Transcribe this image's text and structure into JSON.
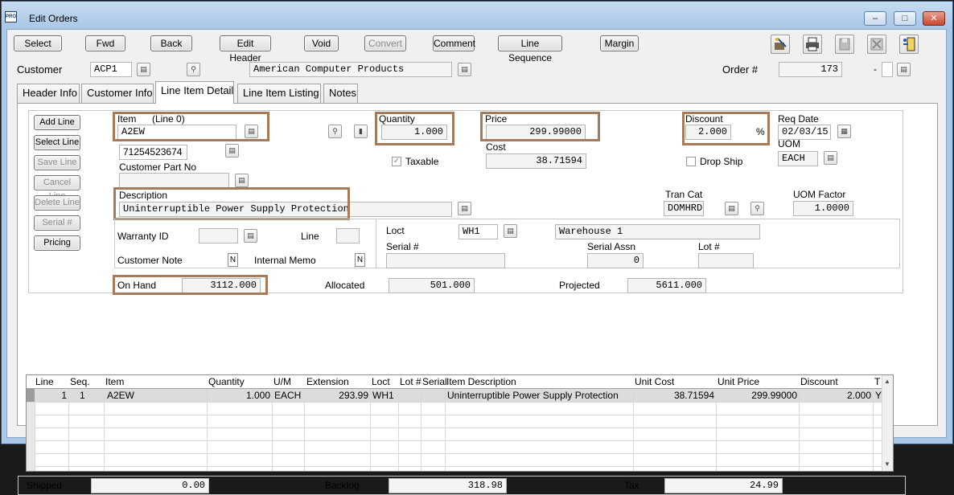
{
  "window": {
    "title": "Edit Orders",
    "app_icon_text": "PRO"
  },
  "toolbar": {
    "buttons": [
      {
        "label": "Select"
      },
      {
        "label": "Fwd"
      },
      {
        "label": "Back"
      },
      {
        "label": "Edit Header"
      },
      {
        "label": "Void"
      },
      {
        "label": "Convert"
      },
      {
        "label": "Comment"
      },
      {
        "label": "Line Sequence"
      },
      {
        "label": "Margin"
      }
    ]
  },
  "header": {
    "customer_label": "Customer",
    "customer_code": "ACP1",
    "customer_name": "American Computer Products",
    "order_label": "Order #",
    "order_number": "173",
    "order_suffix_sep": "-"
  },
  "tabs": [
    {
      "label": "Header Info"
    },
    {
      "label": "Customer Info"
    },
    {
      "label": "Line Item Detail"
    },
    {
      "label": "Line Item Listing"
    },
    {
      "label": "Notes"
    }
  ],
  "side_buttons": [
    {
      "label": "Add Line"
    },
    {
      "label": "Select Line"
    },
    {
      "label": "Save Line"
    },
    {
      "label": "Cancel Line"
    },
    {
      "label": "Delete Line"
    },
    {
      "label": "Serial #"
    },
    {
      "label": "Pricing"
    }
  ],
  "detail": {
    "item_label": "Item",
    "line_label": "(Line 0)",
    "item_value": "A2EW",
    "upc_value": "71254523674",
    "customer_part_label": "Customer Part No",
    "customer_part_value": "",
    "quantity_label": "Quantity",
    "quantity_value": "1.000",
    "taxable_label": "Taxable",
    "price_label": "Price",
    "price_value": "299.99000",
    "cost_label": "Cost",
    "cost_value": "38.71594",
    "discount_label": "Discount",
    "discount_value": "2.000",
    "discount_unit": "%",
    "drop_ship_label": "Drop Ship",
    "req_date_label": "Req Date",
    "req_date_value": "02/03/15",
    "uom_label": "UOM",
    "uom_value": "EACH",
    "description_label": "Description",
    "description_value": "Uninterruptible Power Supply Protection",
    "tran_cat_label": "Tran Cat",
    "tran_cat_value": "DOMHRD",
    "uom_factor_label": "UOM Factor",
    "uom_factor_value": "1.0000",
    "warranty_label": "Warranty ID",
    "line_field_label": "Line",
    "customer_note_label": "Customer Note",
    "customer_note_value": "N",
    "internal_memo_label": "Internal Memo",
    "internal_memo_value": "N",
    "loct_label": "Loct",
    "loct_value": "WH1",
    "warehouse_name": "Warehouse 1",
    "serial_label": "Serial #",
    "serial_assn_label": "Serial Assn",
    "serial_assn_value": "0",
    "lot_label": "Lot #",
    "on_hand_label": "On Hand",
    "on_hand_value": "3112.000",
    "allocated_label": "Allocated",
    "allocated_value": "501.000",
    "projected_label": "Projected",
    "projected_value": "5611.000"
  },
  "grid": {
    "headers": [
      "Line",
      "Seq.",
      "Item",
      "Quantity",
      "U/M",
      "Extension",
      "Loct",
      "Lot #",
      "Serial",
      "Item Description",
      "Unit Cost",
      "Unit Price",
      "Discount",
      "T"
    ],
    "rows": [
      {
        "line": "1",
        "seq": "1",
        "item": "A2EW",
        "quantity": "1.000",
        "um": "EACH",
        "extension": "293.99",
        "loct": "WH1",
        "lot": "",
        "serial": "",
        "description": "Uninterruptible Power Supply Protection",
        "unit_cost": "38.71594",
        "unit_price": "299.99000",
        "discount": "2.000",
        "t": "Y"
      }
    ]
  },
  "totals": {
    "shipped_label": "Shipped",
    "shipped_value": "0.00",
    "backlog_label": "Backlog",
    "backlog_value": "318.98",
    "tax_label": "Tax",
    "tax_value": "24.99"
  }
}
